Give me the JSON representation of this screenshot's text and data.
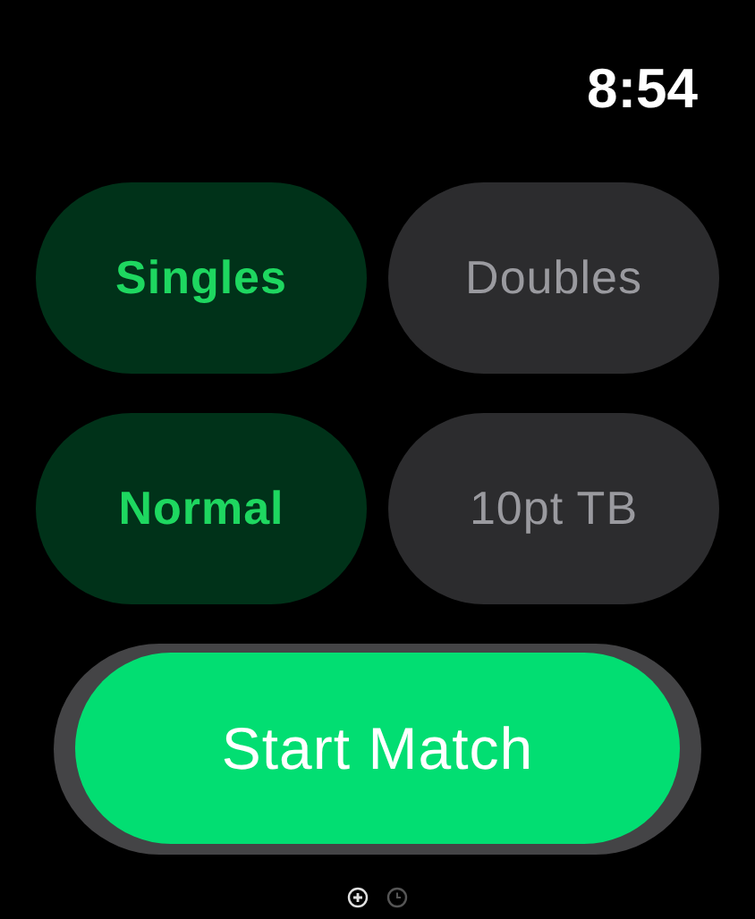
{
  "status_bar": {
    "time": "8:54"
  },
  "option_rows": [
    [
      {
        "label": "Singles",
        "selected": true
      },
      {
        "label": "Doubles",
        "selected": false
      }
    ],
    [
      {
        "label": "Normal",
        "selected": true
      },
      {
        "label": "10pt TB",
        "selected": false
      }
    ]
  ],
  "start_button": {
    "label": "Start Match"
  },
  "page_indicators": [
    {
      "kind": "add",
      "selected": true
    },
    {
      "kind": "clock",
      "selected": false
    }
  ]
}
